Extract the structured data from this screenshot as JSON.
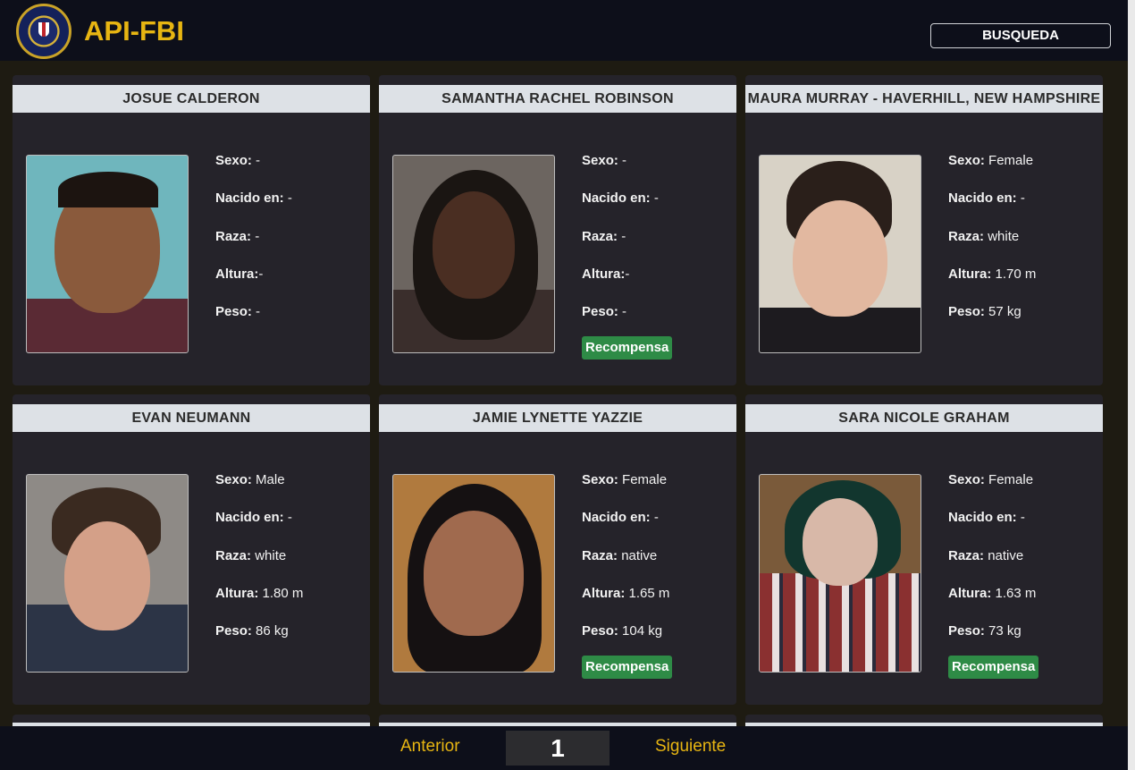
{
  "header": {
    "brand": "API-FBI",
    "search_label": "BUSQUEDA"
  },
  "labels": {
    "sex": "Sexo:",
    "born": "Nacido en:",
    "race": "Raza:",
    "height": "Altura:",
    "weight": "Peso:",
    "reward": "Recompensa"
  },
  "people": [
    {
      "name": "JOSUE CALDERON",
      "sex": "-",
      "born": "-",
      "race": "-",
      "height": "-",
      "weight": "-",
      "reward": false
    },
    {
      "name": "SAMANTHA RACHEL ROBINSON",
      "sex": "-",
      "born": "-",
      "race": "-",
      "height": "-",
      "weight": "-",
      "reward": true
    },
    {
      "name": "MAURA MURRAY - HAVERHILL, NEW HAMPSHIRE",
      "sex": "Female",
      "born": "-",
      "race": "white",
      "height": "1.70 m",
      "weight": "57 kg",
      "reward": false
    },
    {
      "name": "EVAN NEUMANN",
      "sex": "Male",
      "born": "-",
      "race": "white",
      "height": "1.80 m",
      "weight": "86 kg",
      "reward": false
    },
    {
      "name": "JAMIE LYNETTE YAZZIE",
      "sex": "Female",
      "born": "-",
      "race": "native",
      "height": "1.65 m",
      "weight": "104 kg",
      "reward": true
    },
    {
      "name": "SARA NICOLE GRAHAM",
      "sex": "Female",
      "born": "-",
      "race": "native",
      "height": "1.63 m",
      "weight": "73 kg",
      "reward": true
    }
  ],
  "pagination": {
    "prev": "Anterior",
    "page": "1",
    "next": "Siguiente"
  },
  "colors": {
    "accent": "#e7b512",
    "card": "#25232a",
    "reward": "#2e8b46"
  }
}
